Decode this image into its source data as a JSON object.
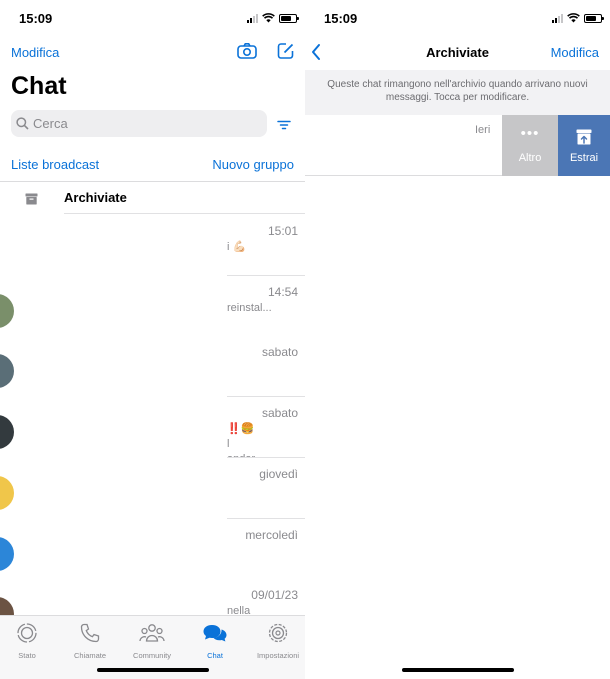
{
  "left": {
    "status_time": "15:09",
    "edit_label": "Modifica",
    "title": "Chat",
    "search_placeholder": "Cerca",
    "broadcast_label": "Liste broadcast",
    "new_group_label": "Nuovo gruppo",
    "archived_label": "Archiviate",
    "chats": [
      {
        "time": "15:01",
        "preview": "i 💪🏻"
      },
      {
        "time": "14:54",
        "preview": "r\reinstal..."
      },
      {
        "time": "sabato",
        "preview": ""
      },
      {
        "time": "sabato",
        "preview": "‼️🍔\nl\nandar..."
      },
      {
        "time": "giovedì",
        "preview": ""
      },
      {
        "time": "mercoledì",
        "preview": ""
      },
      {
        "time": "09/01/23",
        "preview": "nella"
      }
    ],
    "tabs": [
      {
        "label": "Stato",
        "icon": "status-icon"
      },
      {
        "label": "Chiamate",
        "icon": "phone-icon"
      },
      {
        "label": "Community",
        "icon": "community-icon"
      },
      {
        "label": "Chat",
        "icon": "chat-icon"
      },
      {
        "label": "Impostazioni",
        "icon": "settings-icon"
      }
    ],
    "active_tab": "Chat"
  },
  "right": {
    "status_time": "15:09",
    "nav_title": "Archiviate",
    "edit_label": "Modifica",
    "info_text": "Queste chat rimangono nell'archivio quando arrivano nuovi messaggi. Tocca per modificare.",
    "row_time": "Ieri",
    "more_label": "Altro",
    "unarchive_label": "Estrai"
  },
  "colors": {
    "accent": "#0a72d8",
    "unarchive_bg": "#4b76b5",
    "more_bg": "#c6c6c8"
  }
}
